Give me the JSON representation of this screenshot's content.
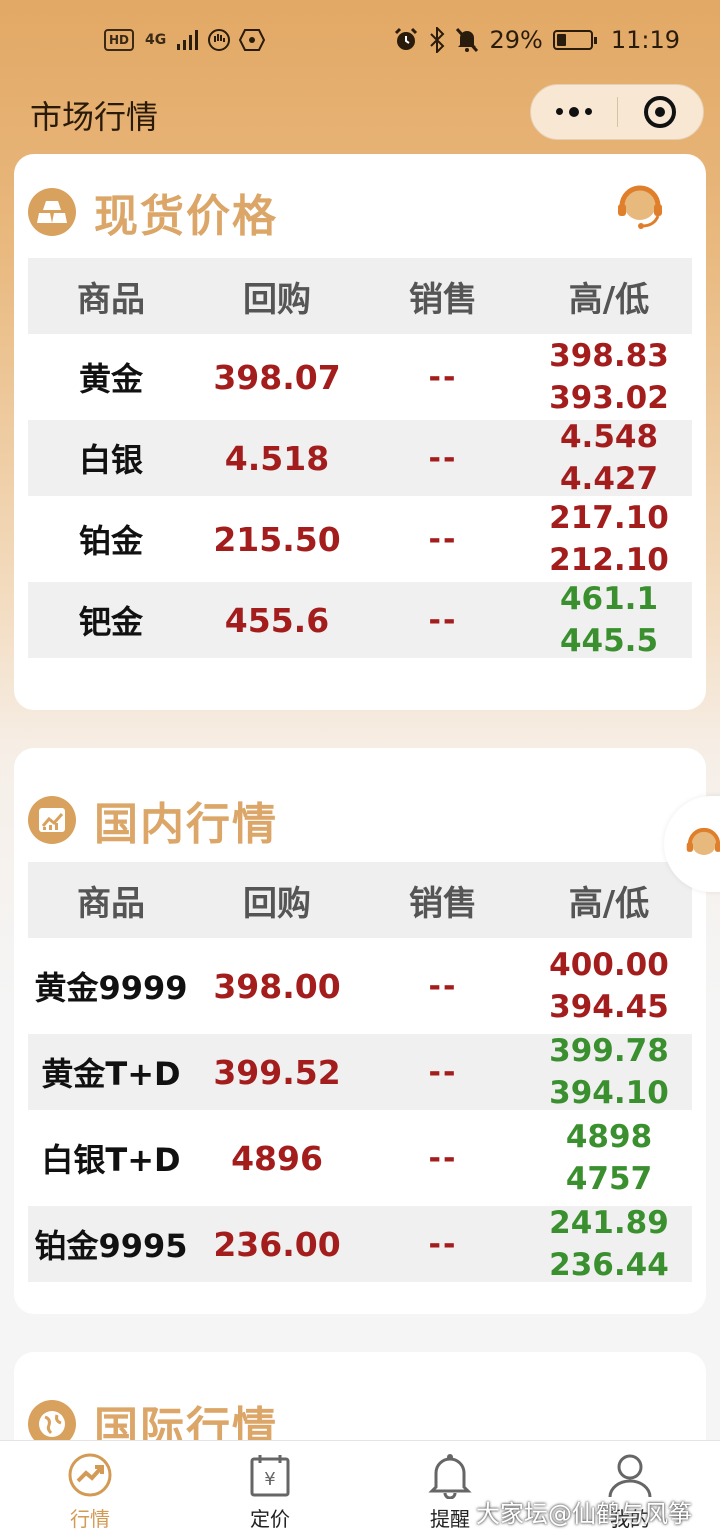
{
  "status_bar": {
    "left_badges": [
      "HD",
      "4G"
    ],
    "battery": "29%",
    "battery_fraction": 0.29,
    "time": "11:19"
  },
  "title_bar": {
    "title": "市场行情"
  },
  "spot": {
    "title": "现货价格",
    "headers": [
      "商品",
      "回购",
      "销售",
      "高/低"
    ],
    "rows": [
      {
        "name": "黄金",
        "buyback": "398.07",
        "sale": "--",
        "high": "398.83",
        "low": "393.02",
        "high_color": "red",
        "low_color": "red"
      },
      {
        "name": "白银",
        "buyback": "4.518",
        "sale": "--",
        "high": "4.548",
        "low": "4.427",
        "high_color": "red",
        "low_color": "red"
      },
      {
        "name": "铂金",
        "buyback": "215.50",
        "sale": "--",
        "high": "217.10",
        "low": "212.10",
        "high_color": "red",
        "low_color": "red"
      },
      {
        "name": "钯金",
        "buyback": "455.6",
        "sale": "--",
        "high": "461.1",
        "low": "445.5",
        "high_color": "green",
        "low_color": "green"
      }
    ]
  },
  "domestic": {
    "title": "国内行情",
    "headers": [
      "商品",
      "回购",
      "销售",
      "高/低"
    ],
    "rows": [
      {
        "name": "黄金9999",
        "buyback": "398.00",
        "sale": "--",
        "high": "400.00",
        "low": "394.45",
        "high_color": "red",
        "low_color": "red"
      },
      {
        "name": "黄金T+D",
        "buyback": "399.52",
        "sale": "--",
        "high": "399.78",
        "low": "394.10",
        "high_color": "green",
        "low_color": "green"
      },
      {
        "name": "白银T+D",
        "buyback": "4896",
        "sale": "--",
        "high": "4898",
        "low": "4757",
        "high_color": "green",
        "low_color": "green"
      },
      {
        "name": "铂金9995",
        "buyback": "236.00",
        "sale": "--",
        "high": "241.89",
        "low": "236.44",
        "high_color": "green",
        "low_color": "green"
      }
    ]
  },
  "international": {
    "title": "国际行情"
  },
  "tabs": [
    {
      "label": "行情",
      "icon": "trend-chart-icon",
      "active": true
    },
    {
      "label": "定价",
      "icon": "calendar-yen-icon",
      "active": false
    },
    {
      "label": "提醒",
      "icon": "bell-icon",
      "active": false
    },
    {
      "label": "我的",
      "icon": "person-icon",
      "active": false
    }
  ],
  "watermark": "大家坛@仙鹤与风筝",
  "colors": {
    "accent": "#dba667",
    "up": "#a31d1d",
    "down": "#3a8f2e"
  }
}
